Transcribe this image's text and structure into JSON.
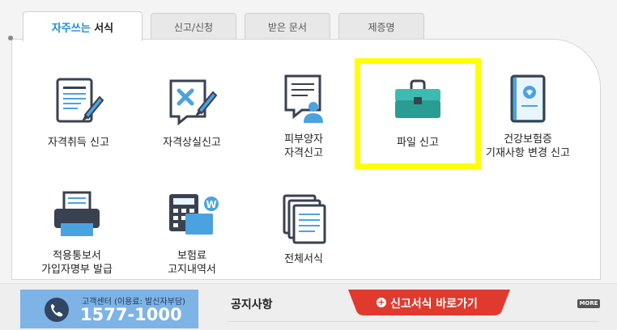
{
  "tabs": [
    {
      "label_highlight": "자주쓰는",
      "label_rest": " 서식"
    },
    {
      "label": "신고/신청"
    },
    {
      "label": "받은 문서"
    },
    {
      "label": "제증명"
    }
  ],
  "forms": [
    {
      "label": "자격취득 신고",
      "icon": "document-pen-icon"
    },
    {
      "label": "자격상실신고",
      "icon": "document-x-pen-icon"
    },
    {
      "label": "피부양자\n자격신고",
      "icon": "document-person-icon"
    },
    {
      "label": "파일 신고",
      "icon": "briefcase-icon"
    },
    {
      "label": "건강보험증\n기재사항 변경 신고",
      "icon": "insurance-card-icon"
    },
    {
      "label": "적용통보서\n가입자명부 발급",
      "icon": "printer-icon"
    },
    {
      "label": "보험료\n고지내역서",
      "icon": "calculator-won-icon"
    },
    {
      "label": "전체서식",
      "icon": "stacked-documents-icon"
    }
  ],
  "customer_center": {
    "label": "고객센터 (이용료: 발신자부담)",
    "phone": "1577-1000"
  },
  "notice": {
    "title": "공지사항",
    "more": "MORE"
  },
  "shortcut": {
    "label": "신고서식 바로가기",
    "plus": "+"
  },
  "colors": {
    "accent": "#1a8fd6",
    "highlight": "#ffff00",
    "shortcut_red": "#e03a2f",
    "cs_blue": "#7eb3e6"
  }
}
